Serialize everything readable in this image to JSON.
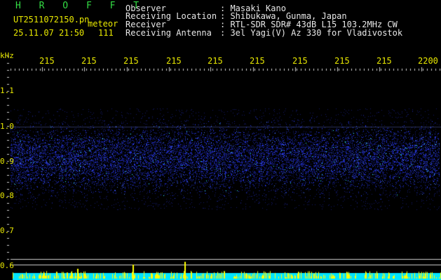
{
  "header": {
    "app_title": "H R O F F T",
    "filename": "UT2511072150.pn",
    "mode": "meteor",
    "datetime": "25.11.07 21:50",
    "count": "111"
  },
  "station": {
    "observer_label": "Observer",
    "observer_value": ": Masaki Kano",
    "location_label": "Receiving Location",
    "location_value": ": Shibukawa, Gunma, Japan",
    "receiver_label": "Receiver",
    "receiver_value": ": RTL-SDR SDR# 43dB L15 103.2MHz CW",
    "antenna_label": "Receiving Antenna",
    "antenna_value": ": 3el Yagi(V) Az 330 for Vladivostok"
  },
  "axis": {
    "y_unit": "kHz",
    "y_ticks": [
      "1.1",
      "1.0",
      "0.9",
      "0.8",
      "0.7",
      "0.6"
    ],
    "x_ticks": [
      "215",
      "215",
      "215",
      "215",
      "215",
      "215",
      "215",
      "215",
      "215",
      "2200"
    ]
  },
  "colors": {
    "background": "#000000",
    "text_yellow": "#e8e800",
    "text_white": "#e8e8e8",
    "title_green": "#33dd44",
    "signal_blue": "#2a3cff",
    "signal_cyan": "#33ffff",
    "bar_cyan": "#00e5ff",
    "bar_yellow": "#ffff00"
  }
}
